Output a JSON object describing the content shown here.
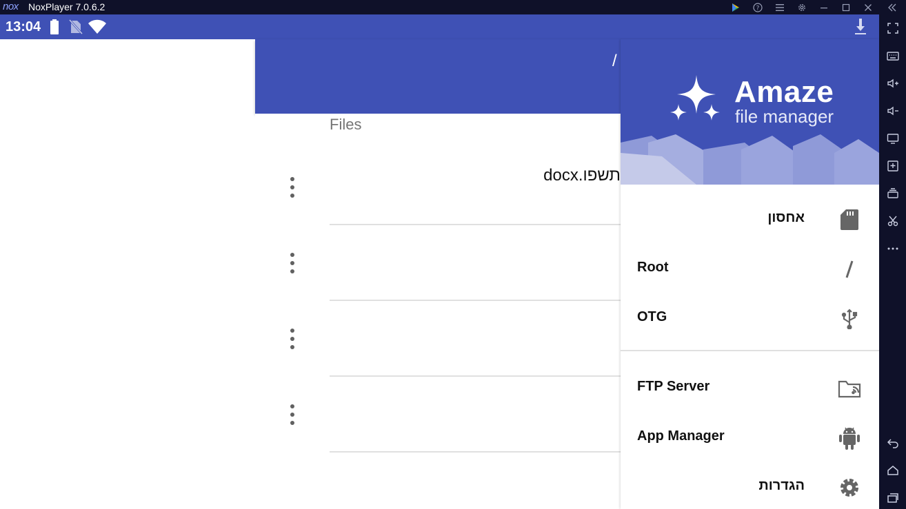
{
  "window": {
    "logo_text": "nox",
    "title": "NoxPlayer 7.0.6.2"
  },
  "status_bar": {
    "time": "13:04"
  },
  "app_bar": {
    "path": "/"
  },
  "content": {
    "section_label": "Files",
    "rows": [
      {
        "name": "docx.תשפו"
      },
      {
        "name": ""
      },
      {
        "name": ""
      },
      {
        "name": ""
      }
    ]
  },
  "drawer": {
    "brand_title": "Amaze",
    "brand_subtitle": "file manager",
    "items": [
      {
        "label": "אחסון",
        "icon": "sd-card-icon"
      },
      {
        "label": "Root",
        "icon": "slash-icon"
      },
      {
        "label": "OTG",
        "icon": "usb-icon"
      },
      {
        "label": "FTP Server",
        "icon": "ftp-folder-icon"
      },
      {
        "label": "App Manager",
        "icon": "android-icon"
      },
      {
        "label": "הגדרות",
        "icon": "settings-gear-icon"
      }
    ]
  },
  "colors": {
    "primary": "#3f51b5",
    "nox_frame": "#0f1129"
  }
}
